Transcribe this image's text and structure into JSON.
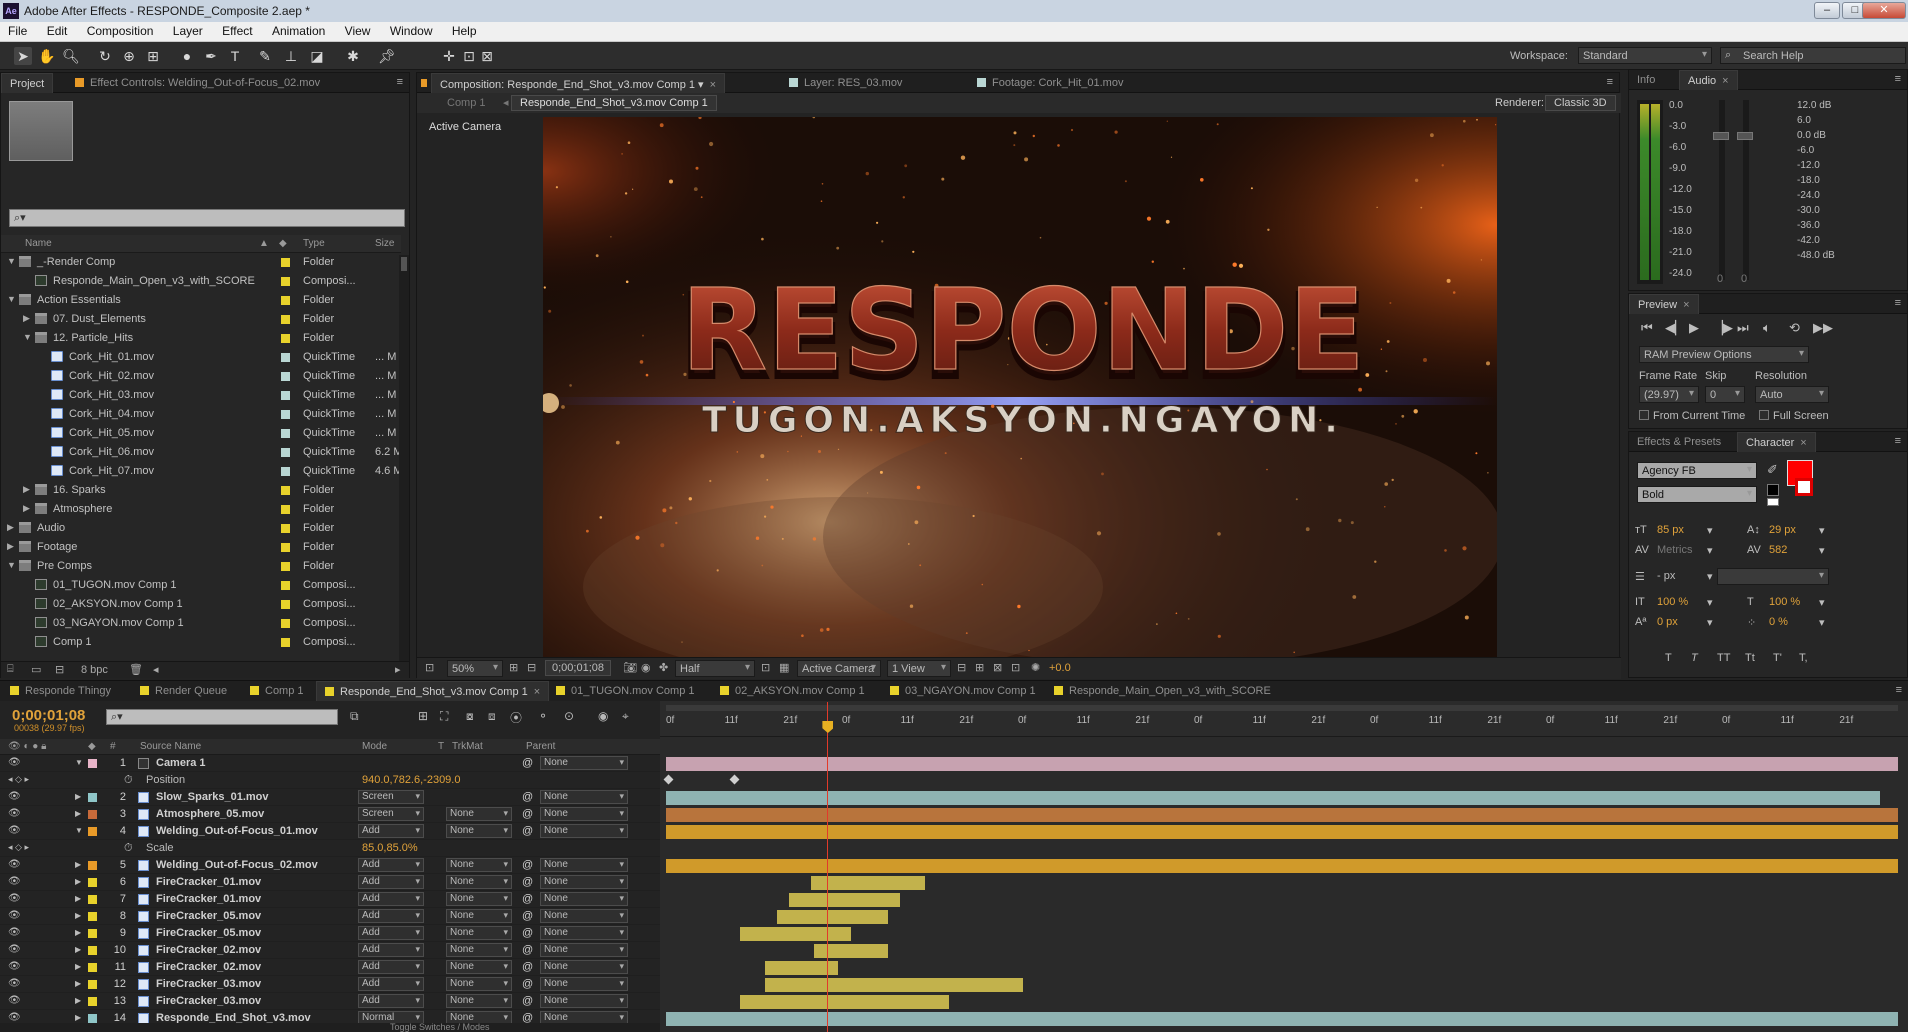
{
  "window": {
    "title": "Adobe After Effects - RESPONDE_Composite 2.aep *",
    "buttons": [
      "–",
      "□",
      "✕"
    ]
  },
  "menu": [
    "File",
    "Edit",
    "Composition",
    "Layer",
    "Effect",
    "Animation",
    "View",
    "Window",
    "Help"
  ],
  "toolbar": {
    "workspace_label": "Workspace:",
    "workspace_value": "Standard",
    "search_placeholder": "Search Help"
  },
  "project": {
    "tabs": [
      "Project",
      "Effect Controls: Welding_Out-of-Focus_02.mov"
    ],
    "columns": {
      "name": "Name",
      "type": "Type",
      "size": "Size"
    },
    "items": [
      {
        "indent": 0,
        "twirl": "▼",
        "icon": "folder",
        "name": "_-Render Comp",
        "label": "#e8d22b",
        "type": "Folder",
        "size": ""
      },
      {
        "indent": 1,
        "twirl": "",
        "icon": "comp",
        "name": "Responde_Main_Open_v3_with_SCORE",
        "label": "#e8d22b",
        "type": "Composi...",
        "size": ""
      },
      {
        "indent": 0,
        "twirl": "▼",
        "icon": "folder",
        "name": "Action Essentials",
        "label": "#e8d22b",
        "type": "Folder",
        "size": ""
      },
      {
        "indent": 1,
        "twirl": "▶",
        "icon": "folder",
        "name": "07. Dust_Elements",
        "label": "#e8d22b",
        "type": "Folder",
        "size": ""
      },
      {
        "indent": 1,
        "twirl": "▼",
        "icon": "folder",
        "name": "12. Particle_Hits",
        "label": "#e8d22b",
        "type": "Folder",
        "size": ""
      },
      {
        "indent": 2,
        "twirl": "",
        "icon": "qt",
        "name": "Cork_Hit_01.mov",
        "label": "#b9d6d3",
        "type": "QuickTime",
        "size": "... M"
      },
      {
        "indent": 2,
        "twirl": "",
        "icon": "qt",
        "name": "Cork_Hit_02.mov",
        "label": "#b9d6d3",
        "type": "QuickTime",
        "size": "... M"
      },
      {
        "indent": 2,
        "twirl": "",
        "icon": "qt",
        "name": "Cork_Hit_03.mov",
        "label": "#b9d6d3",
        "type": "QuickTime",
        "size": "... M"
      },
      {
        "indent": 2,
        "twirl": "",
        "icon": "qt",
        "name": "Cork_Hit_04.mov",
        "label": "#b9d6d3",
        "type": "QuickTime",
        "size": "... M"
      },
      {
        "indent": 2,
        "twirl": "",
        "icon": "qt",
        "name": "Cork_Hit_05.mov",
        "label": "#b9d6d3",
        "type": "QuickTime",
        "size": "... M"
      },
      {
        "indent": 2,
        "twirl": "",
        "icon": "qt",
        "name": "Cork_Hit_06.mov",
        "label": "#b9d6d3",
        "type": "QuickTime",
        "size": "6.2 M"
      },
      {
        "indent": 2,
        "twirl": "",
        "icon": "qt",
        "name": "Cork_Hit_07.mov",
        "label": "#b9d6d3",
        "type": "QuickTime",
        "size": "4.6 M"
      },
      {
        "indent": 1,
        "twirl": "▶",
        "icon": "folder",
        "name": "16. Sparks",
        "label": "#e8d22b",
        "type": "Folder",
        "size": ""
      },
      {
        "indent": 1,
        "twirl": "▶",
        "icon": "folder",
        "name": "Atmosphere",
        "label": "#e8d22b",
        "type": "Folder",
        "size": ""
      },
      {
        "indent": 0,
        "twirl": "▶",
        "icon": "folder",
        "name": "Audio",
        "label": "#e8d22b",
        "type": "Folder",
        "size": ""
      },
      {
        "indent": 0,
        "twirl": "▶",
        "icon": "folder",
        "name": "Footage",
        "label": "#e8d22b",
        "type": "Folder",
        "size": ""
      },
      {
        "indent": 0,
        "twirl": "▼",
        "icon": "folder",
        "name": "Pre Comps",
        "label": "#e8d22b",
        "type": "Folder",
        "size": ""
      },
      {
        "indent": 1,
        "twirl": "",
        "icon": "comp",
        "name": "01_TUGON.mov Comp 1",
        "label": "#e8d22b",
        "type": "Composi...",
        "size": ""
      },
      {
        "indent": 1,
        "twirl": "",
        "icon": "comp",
        "name": "02_AKSYON.mov Comp 1",
        "label": "#e8d22b",
        "type": "Composi...",
        "size": ""
      },
      {
        "indent": 1,
        "twirl": "",
        "icon": "comp",
        "name": "03_NGAYON.mov Comp 1",
        "label": "#e8d22b",
        "type": "Composi...",
        "size": ""
      },
      {
        "indent": 1,
        "twirl": "",
        "icon": "comp",
        "name": "Comp 1",
        "label": "#e8d22b",
        "type": "Composi...",
        "size": ""
      }
    ],
    "bpc": "8 bpc"
  },
  "composition": {
    "tabs": [
      "Composition: Responde_End_Shot_v3.mov Comp 1",
      "Layer: RES_03.mov",
      "Footage: Cork_Hit_01.mov"
    ],
    "flowchart": [
      "Comp 1",
      "Responde_End_Shot_v3.mov Comp 1"
    ],
    "renderer_label": "Renderer:",
    "renderer_value": "Classic 3D",
    "view_label": "Active Camera",
    "frame": {
      "title": "RESPONDE",
      "tagline": "TUGON.AKSYON.NGAYON."
    },
    "bottom": {
      "zoom": "50%",
      "timecode": "0;00;01;08",
      "resolution": "Half",
      "camera": "Active Camera",
      "views": "1 View",
      "exposure": "+0.0"
    }
  },
  "audio": {
    "tabs": [
      "Info",
      "Audio"
    ],
    "left_scale": [
      "0.0",
      "-3.0",
      "-6.0",
      "-9.0",
      "-12.0",
      "-15.0",
      "-18.0",
      "-21.0",
      "-24.0"
    ],
    "right_scale": [
      "12.0 dB",
      "6.0",
      "0.0 dB",
      "-6.0",
      "-12.0",
      "-18.0",
      "-24.0",
      "-30.0",
      "-36.0",
      "-42.0",
      "-48.0 dB"
    ],
    "fader_values": [
      "0",
      "0"
    ]
  },
  "preview": {
    "tab": "Preview",
    "options": "RAM Preview Options",
    "frame_rate_label": "Frame Rate",
    "skip_label": "Skip",
    "resolution_label": "Resolution",
    "frame_rate": "(29.97)",
    "skip": "0",
    "resolution": "Auto",
    "from_current": "From Current Time",
    "full_screen": "Full Screen"
  },
  "character": {
    "tabs": [
      "Effects & Presets",
      "Character"
    ],
    "font": "Agency FB",
    "style": "Bold",
    "font_size": "85 px",
    "leading": "29 px",
    "kerning": "Metrics",
    "tracking": "582",
    "stroke": "- px",
    "vscale": "100 %",
    "hscale": "100 %",
    "baseline": "0 px",
    "tsume": "0 %",
    "fill_color": "#ff0000",
    "text_styles": [
      "T",
      "T",
      "TT",
      "Tt",
      "T'",
      "T,"
    ]
  },
  "timeline": {
    "tabs": [
      "Responde Thingy",
      "Render Queue",
      "Comp 1",
      "Responde_End_Shot_v3.mov Comp 1",
      "01_TUGON.mov Comp 1",
      "02_AKSYON.mov Comp 1",
      "03_NGAYON.mov Comp 1",
      "Responde_Main_Open_v3_with_SCORE"
    ],
    "timecode": "0;00;01;08",
    "frames": "00038 (29.97 fps)",
    "columns": {
      "source": "Source Name",
      "mode": "Mode",
      "t": "T",
      "trkmat": "TrkMat",
      "parent": "Parent"
    },
    "ruler": [
      "0f",
      "11f",
      "21f",
      "0f",
      "11f",
      "21f",
      "0f",
      "11f",
      "21f",
      "0f",
      "11f",
      "21f",
      "0f",
      "11f",
      "21f",
      "0f",
      "11f",
      "21f",
      "0f",
      "11f",
      "21f"
    ],
    "rows": [
      {
        "kind": "layer",
        "num": "1",
        "name": "Camera 1",
        "label": "#e8b4c8",
        "mode": "",
        "trkmat": "",
        "parent": "None",
        "twirl": "▼",
        "camera": true,
        "bar": {
          "start": 0,
          "end": 1,
          "color": "#c7a2b0"
        }
      },
      {
        "kind": "prop",
        "name": "Position",
        "value": "940.0,782.6,-2309.0",
        "keys": [
          0.001,
          0.054
        ]
      },
      {
        "kind": "layer",
        "num": "2",
        "name": "Slow_Sparks_01.mov",
        "label": "#8fc6c8",
        "mode": "Screen",
        "trkmat": "",
        "parent": "None",
        "twirl": "▶",
        "bar": {
          "start": 0,
          "end": 0.985,
          "color": "#8fb3b2"
        }
      },
      {
        "kind": "layer",
        "num": "3",
        "name": "Atmosphere_05.mov",
        "label": "#c86a3a",
        "mode": "Screen",
        "trkmat": "None",
        "parent": "None",
        "twirl": "▶",
        "bar": {
          "start": 0,
          "end": 1,
          "color": "#b8743c"
        }
      },
      {
        "kind": "layer",
        "num": "4",
        "name": "Welding_Out-of-Focus_01.mov",
        "label": "#e89a28",
        "mode": "Add",
        "trkmat": "None",
        "parent": "None",
        "twirl": "▼",
        "bar": {
          "start": 0,
          "end": 1,
          "color": "#d09a2a"
        }
      },
      {
        "kind": "prop",
        "name": "Scale",
        "value": "85.0,85.0%",
        "keys": []
      },
      {
        "kind": "layer",
        "num": "5",
        "name": "Welding_Out-of-Focus_02.mov",
        "label": "#e89a28",
        "mode": "Add",
        "trkmat": "None",
        "parent": "None",
        "twirl": "▶",
        "bar": {
          "start": 0,
          "end": 1,
          "color": "#d09a2a"
        }
      },
      {
        "kind": "layer",
        "num": "6",
        "name": "FireCracker_01.mov",
        "label": "#e8d22b",
        "mode": "Add",
        "trkmat": "None",
        "parent": "None",
        "twirl": "▶",
        "bar": {
          "start": 0.118,
          "end": 0.21,
          "color": "#c2b24c"
        }
      },
      {
        "kind": "layer",
        "num": "7",
        "name": "FireCracker_01.mov",
        "label": "#e8d22b",
        "mode": "Add",
        "trkmat": "None",
        "parent": "None",
        "twirl": "▶",
        "bar": {
          "start": 0.1,
          "end": 0.19,
          "color": "#c2b24c"
        }
      },
      {
        "kind": "layer",
        "num": "8",
        "name": "FireCracker_05.mov",
        "label": "#e8d22b",
        "mode": "Add",
        "trkmat": "None",
        "parent": "None",
        "twirl": "▶",
        "bar": {
          "start": 0.09,
          "end": 0.18,
          "color": "#c2b24c"
        }
      },
      {
        "kind": "layer",
        "num": "9",
        "name": "FireCracker_05.mov",
        "label": "#e8d22b",
        "mode": "Add",
        "trkmat": "None",
        "parent": "None",
        "twirl": "▶",
        "bar": {
          "start": 0.06,
          "end": 0.15,
          "color": "#c2b24c"
        }
      },
      {
        "kind": "layer",
        "num": "10",
        "name": "FireCracker_02.mov",
        "label": "#e8d22b",
        "mode": "Add",
        "trkmat": "None",
        "parent": "None",
        "twirl": "▶",
        "bar": {
          "start": 0.12,
          "end": 0.18,
          "color": "#c2b24c"
        }
      },
      {
        "kind": "layer",
        "num": "11",
        "name": "FireCracker_02.mov",
        "label": "#e8d22b",
        "mode": "Add",
        "trkmat": "None",
        "parent": "None",
        "twirl": "▶",
        "bar": {
          "start": 0.08,
          "end": 0.14,
          "color": "#c2b24c"
        }
      },
      {
        "kind": "layer",
        "num": "12",
        "name": "FireCracker_03.mov",
        "label": "#e8d22b",
        "mode": "Add",
        "trkmat": "None",
        "parent": "None",
        "twirl": "▶",
        "bar": {
          "start": 0.08,
          "end": 0.29,
          "color": "#c2b24c"
        }
      },
      {
        "kind": "layer",
        "num": "13",
        "name": "FireCracker_03.mov",
        "label": "#e8d22b",
        "mode": "Add",
        "trkmat": "None",
        "parent": "None",
        "twirl": "▶",
        "bar": {
          "start": 0.06,
          "end": 0.23,
          "color": "#c2b24c"
        }
      },
      {
        "kind": "layer",
        "num": "14",
        "name": "Responde_End_Shot_v3.mov",
        "label": "#8fc6c8",
        "mode": "Normal",
        "trkmat": "None",
        "parent": "None",
        "twirl": "▶",
        "bar": {
          "start": 0,
          "end": 1,
          "color": "#8fb3b2"
        }
      }
    ],
    "toggle_label": "Toggle Switches / Modes",
    "playhead": 0.131
  }
}
